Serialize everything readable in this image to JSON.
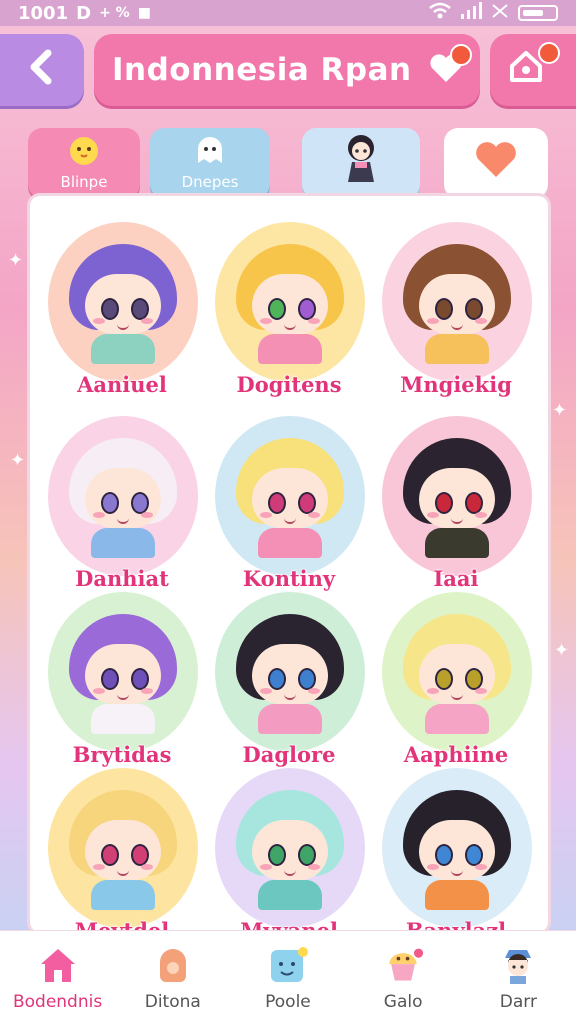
{
  "status_bar": {
    "time": "1001",
    "icons_left": [
      "D",
      "+ %",
      "■"
    ]
  },
  "header": {
    "back_icon": "chevron-left-icon",
    "title": "Indonnesia Rpan",
    "heart_icon": "heart-icon",
    "home_icon": "home-icon"
  },
  "tabs": [
    {
      "label": "Blinpe",
      "icon": "chick-icon"
    },
    {
      "label": "Dnepes",
      "icon": "ghost-icon"
    },
    {
      "label": "",
      "icon": "doll-icon"
    },
    {
      "label": "",
      "icon": "heart-icon"
    }
  ],
  "characters": [
    {
      "name": "Aaniuel",
      "hair": "#7d63d1",
      "bg": "#fcd1c2",
      "outfit": "#8dd1c1"
    },
    {
      "name": "Dogitens",
      "hair": "#f7c54a",
      "bg": "#fde6a3",
      "outfit": "#f590b5"
    },
    {
      "name": "Mngiekig",
      "hair": "#8a5233",
      "bg": "#fbd3e0",
      "outfit": "#f6c05a"
    },
    {
      "name": "Danhiat",
      "hair": "#f6eef4",
      "bg": "#fad4e6",
      "outfit": "#8ab8e8"
    },
    {
      "name": "Kontiny",
      "hair": "#f8e07b",
      "bg": "#cfe8f4",
      "outfit": "#f48fb5"
    },
    {
      "name": "Iaai",
      "hair": "#2b2430",
      "bg": "#f9c6d8",
      "outfit": "#3b3a2e"
    },
    {
      "name": "Brytidas",
      "hair": "#9a6ad8",
      "bg": "#d8f1d2",
      "outfit": "#f7f2f8"
    },
    {
      "name": "Daglore",
      "hair": "#2a2430",
      "bg": "#cfeed8",
      "outfit": "#f39bc0"
    },
    {
      "name": "Aaphiine",
      "hair": "#f7e58a",
      "bg": "#def4c8",
      "outfit": "#f5a4c6"
    },
    {
      "name": "Mevtdel",
      "hair": "#f6d57c",
      "bg": "#fde5a1",
      "outfit": "#89c8e8"
    },
    {
      "name": "Mvvanel",
      "hair": "#a6e6df",
      "bg": "#e6d9f7",
      "outfit": "#6cc7c0"
    },
    {
      "name": "Banylazl",
      "hair": "#27212b",
      "bg": "#d9ecf7",
      "outfit": "#f39149"
    }
  ],
  "bottom_nav": [
    {
      "label": "Bodendnis",
      "icon": "home-icon",
      "active": true
    },
    {
      "label": "Ditona",
      "icon": "cookie-icon",
      "active": false
    },
    {
      "label": "Poole",
      "icon": "smile-block-icon",
      "active": false
    },
    {
      "label": "Galo",
      "icon": "cupcake-icon",
      "active": false
    },
    {
      "label": "Darr",
      "icon": "profile-icon",
      "active": false
    }
  ]
}
